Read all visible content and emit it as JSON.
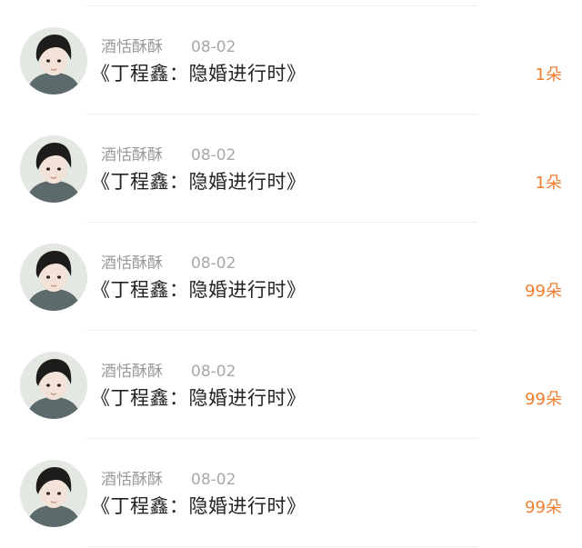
{
  "items": [
    {
      "username": "酒恬酥酥",
      "date": "08-02",
      "title": "《丁程鑫：隐婚进行时》",
      "count": "1朵"
    },
    {
      "username": "酒恬酥酥",
      "date": "08-02",
      "title": "《丁程鑫：隐婚进行时》",
      "count": "1朵"
    },
    {
      "username": "酒恬酥酥",
      "date": "08-02",
      "title": "《丁程鑫：隐婚进行时》",
      "count": "99朵"
    },
    {
      "username": "酒恬酥酥",
      "date": "08-02",
      "title": "《丁程鑫：隐婚进行时》",
      "count": "99朵"
    },
    {
      "username": "酒恬酥酥",
      "date": "08-02",
      "title": "《丁程鑫：隐婚进行时》",
      "count": "99朵"
    }
  ],
  "icons": {
    "avatar": "user-avatar-photo"
  },
  "colors": {
    "count": "#f07e30",
    "username": "#9a9a9a",
    "title": "#222222"
  }
}
